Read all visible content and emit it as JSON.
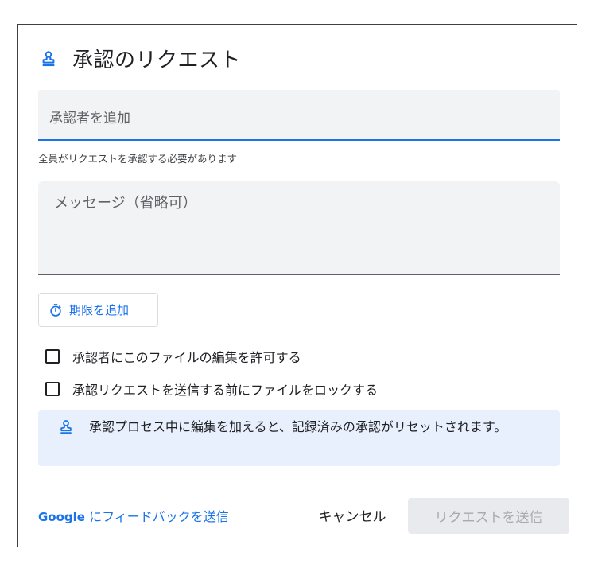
{
  "dialog": {
    "title": "承認のリクエスト",
    "title_icon": "approval-stamp-icon"
  },
  "approvers": {
    "placeholder": "承認者を追加",
    "value": "",
    "helper_text": "全員がリクエストを承認する必要があります"
  },
  "message": {
    "placeholder": "メッセージ（省略可）",
    "value": ""
  },
  "deadline": {
    "label": "期限を追加",
    "icon": "timer-icon"
  },
  "options": [
    {
      "label": "承認者にこのファイルの編集を許可する",
      "checked": false
    },
    {
      "label": "承認リクエストを送信する前にファイルをロックする",
      "checked": false
    }
  ],
  "info": {
    "icon": "approval-stamp-icon",
    "text": "承認プロセス中に編集を加えると、記録済みの承認がリセットされます。"
  },
  "footer": {
    "feedback_brand": "Google",
    "feedback_text": " にフィードバックを送信",
    "cancel_label": "キャンセル",
    "send_label": "リクエストを送信",
    "send_enabled": false
  },
  "colors": {
    "accent": "#1a73e8",
    "field_bg": "#f1f3f4",
    "info_bg": "#e8f0fe",
    "disabled_bg": "#e8eaed",
    "disabled_text": "#a8aaad"
  }
}
